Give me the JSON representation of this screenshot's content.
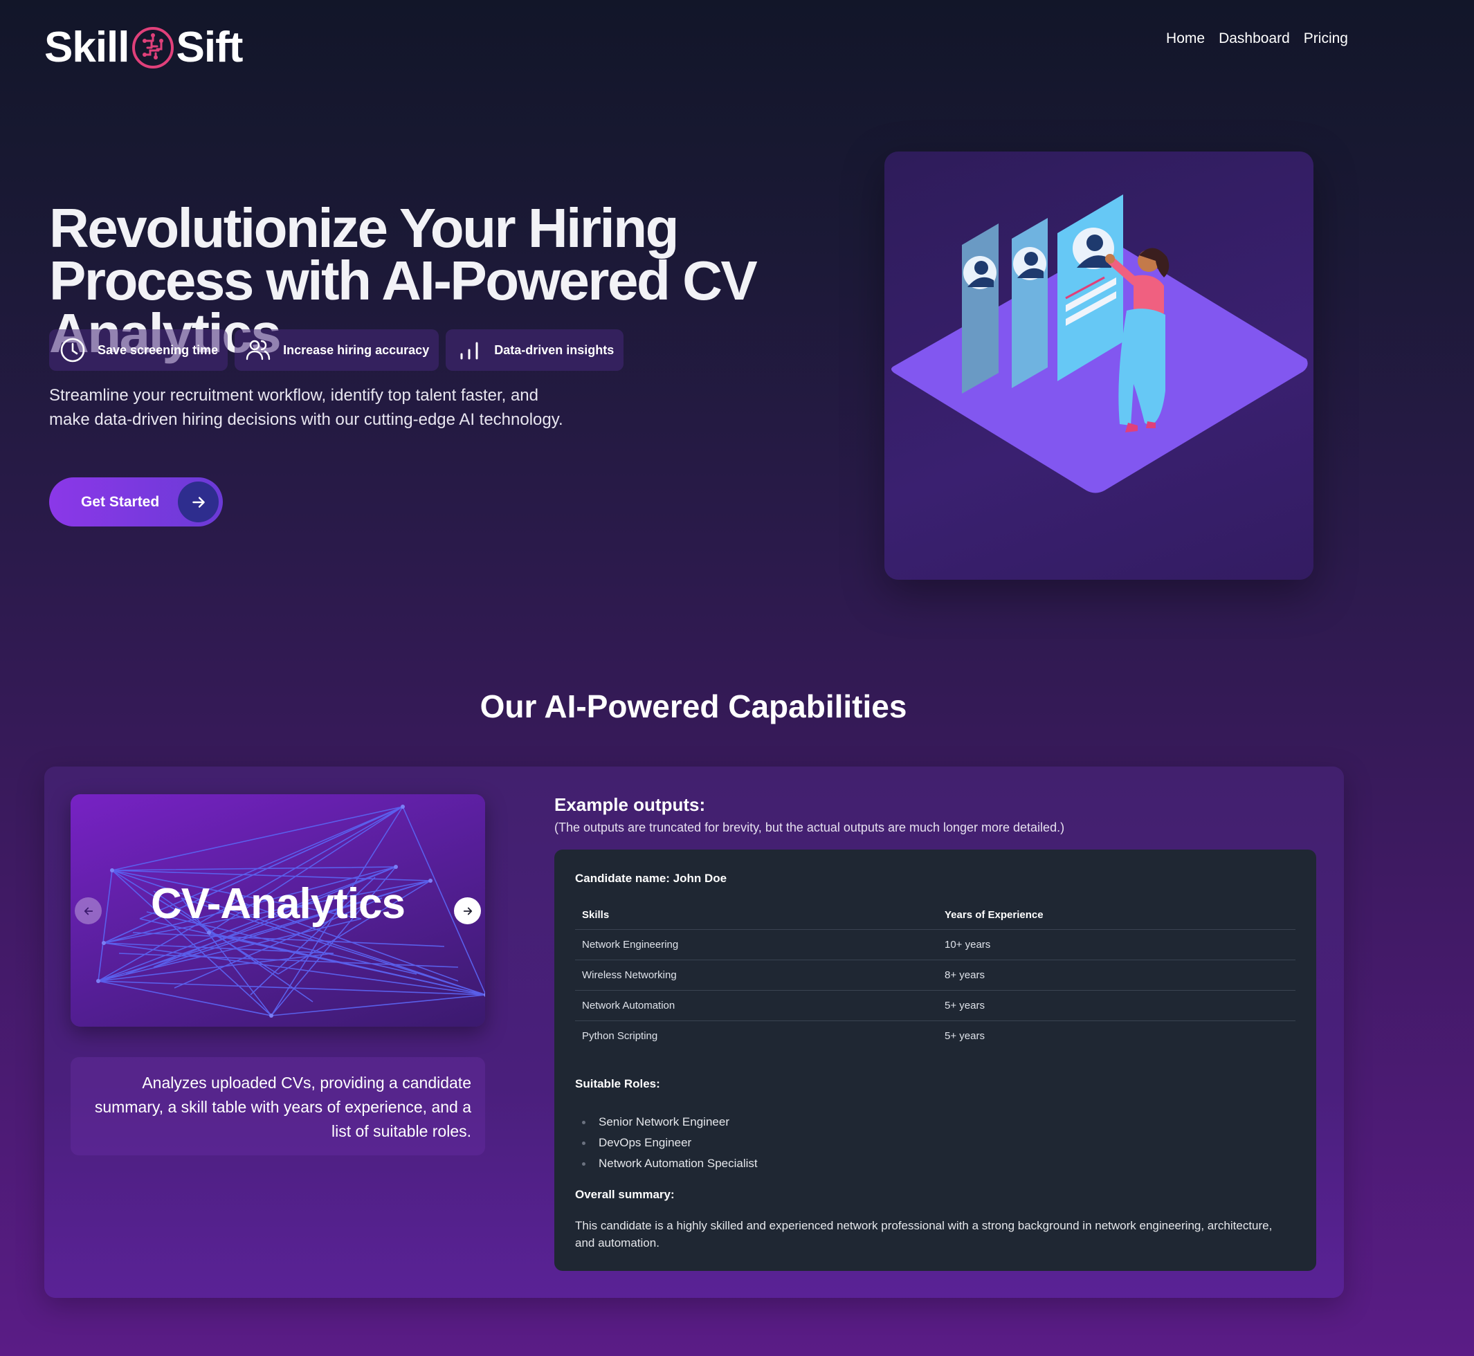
{
  "brand": {
    "name_left": "Skill",
    "name_right": "Sift"
  },
  "nav": {
    "items": [
      "Home",
      "Dashboard",
      "Pricing"
    ]
  },
  "hero": {
    "title": "Revolutionize Your Hiring Process with AI-Powered CV Analytics",
    "chips": [
      {
        "icon": "clock-icon",
        "label": "Save screening time"
      },
      {
        "icon": "users-icon",
        "label": "Increase hiring accuracy"
      },
      {
        "icon": "bar-chart-icon",
        "label": "Data-driven insights"
      }
    ],
    "description": "Streamline your recruitment workflow, identify top talent faster, and make data-driven hiring decisions with our cutting-edge AI technology.",
    "cta_label": "Get Started"
  },
  "capabilities": {
    "title": "Our AI-Powered Capabilities",
    "carousel": {
      "slide_title": "CV-Analytics",
      "description": "Analyzes uploaded CVs, providing a candidate summary, a skill table with years of experience, and a list of suitable roles."
    },
    "example": {
      "title": "Example outputs:",
      "note": "(The outputs are truncated for brevity, but the actual outputs are much longer more detailed.)",
      "candidate_label": "Candidate name: John Doe",
      "table": {
        "headers": [
          "Skills",
          "Years of Experience"
        ],
        "rows": [
          [
            "Network Engineering",
            "10+ years"
          ],
          [
            "Wireless Networking",
            "8+ years"
          ],
          [
            "Network Automation",
            "5+ years"
          ],
          [
            "Python Scripting",
            "5+ years"
          ]
        ]
      },
      "roles_label": "Suitable Roles:",
      "roles": [
        "Senior Network Engineer",
        "DevOps Engineer",
        "Network Automation Specialist"
      ],
      "summary_label": "Overall summary:",
      "summary": "This candidate is a highly skilled and experienced network professional with a strong background in network engineering, architecture, and automation."
    }
  },
  "colors": {
    "accent": "#8b38e8",
    "accent_dark": "#2e2d8e",
    "logo_mark": "#e0407a",
    "panel": "#1f2733"
  }
}
